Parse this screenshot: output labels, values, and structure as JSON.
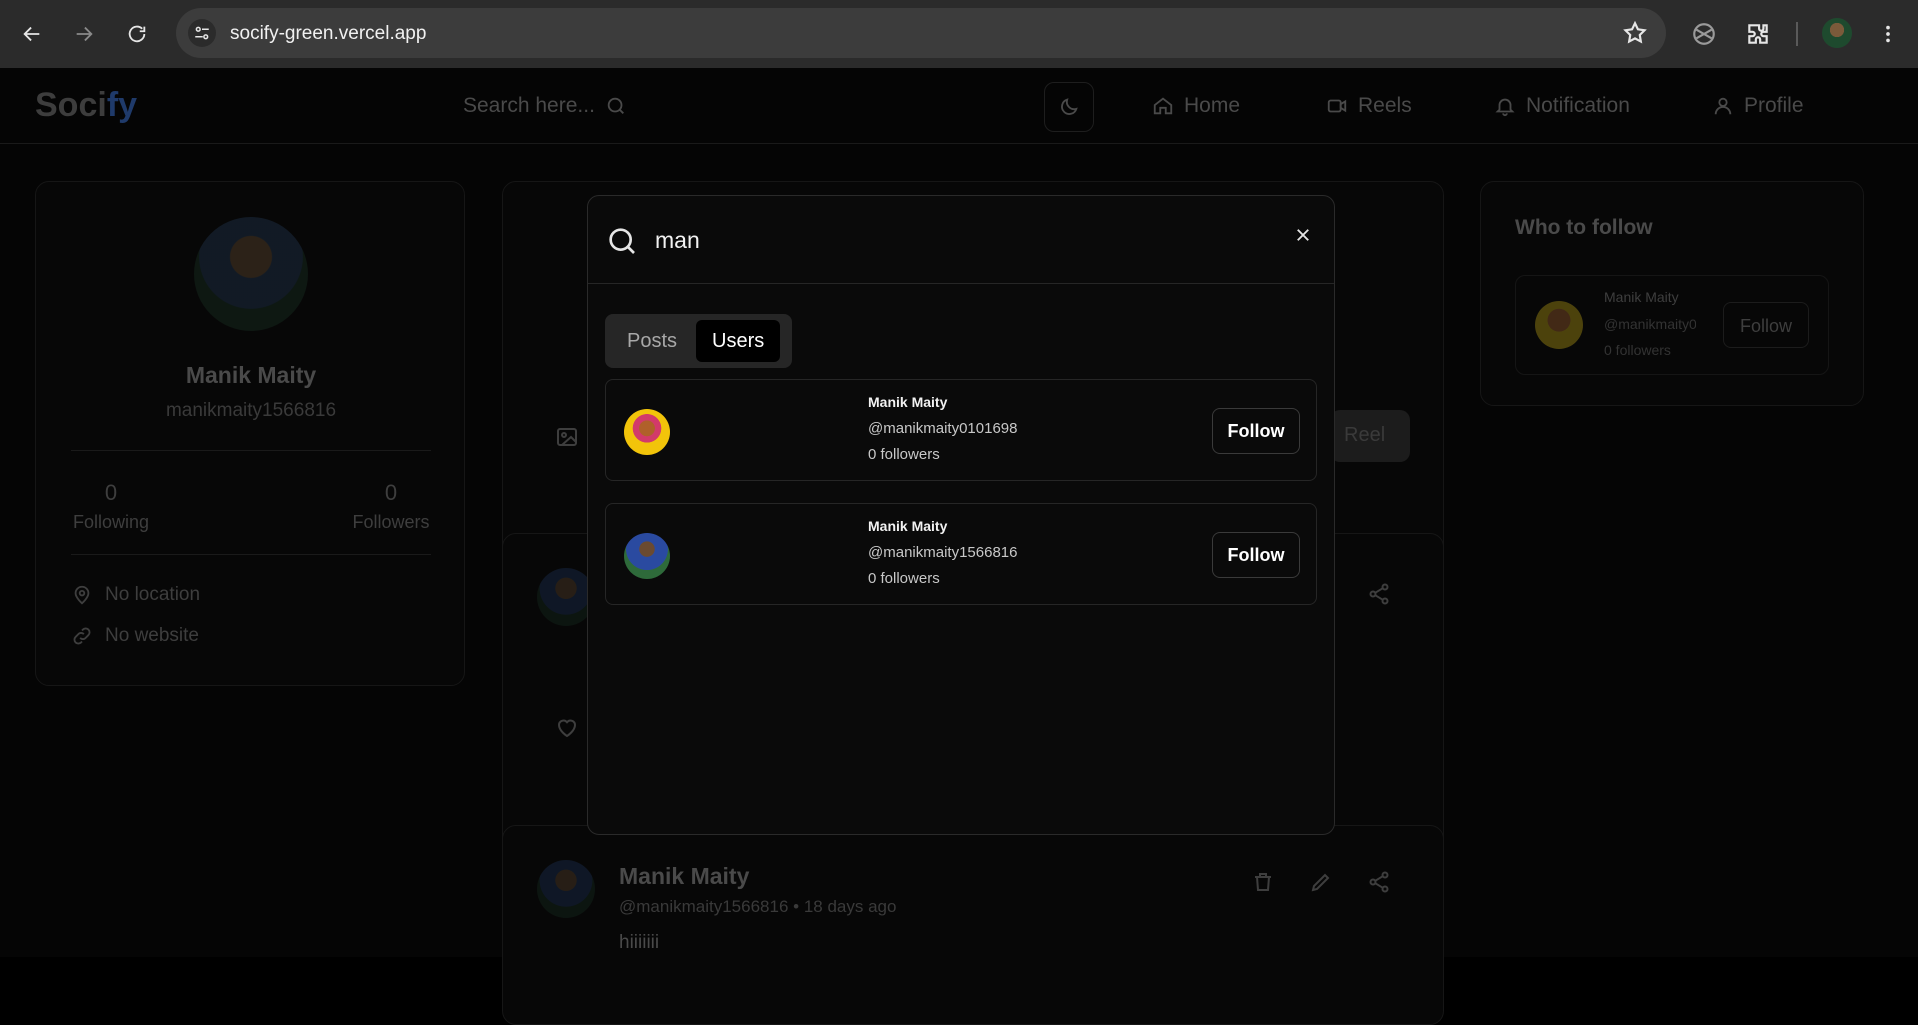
{
  "browser": {
    "url": "socify-green.vercel.app"
  },
  "app": {
    "logo_main": "Soci",
    "logo_accent": "fy",
    "search_placeholder": "Search here...",
    "nav": [
      {
        "label": "Home",
        "icon": "home-icon"
      },
      {
        "label": "Reels",
        "icon": "video-icon"
      },
      {
        "label": "Notification",
        "icon": "bell-icon"
      },
      {
        "label": "Profile",
        "icon": "user-icon"
      }
    ],
    "profile": {
      "name": "Manik Maity",
      "username": "manikmaity1566816",
      "following_count": "0",
      "following_label": "Following",
      "followers_count": "0",
      "followers_label": "Followers",
      "location": "No location",
      "website": "No website"
    },
    "composer": {
      "reel_button_partial": "Reel"
    },
    "post": {
      "author": "Manik Maity",
      "handle": "@manikmaity1566816",
      "separator": "•",
      "time": "18 days ago",
      "body": "hiiiiiii"
    },
    "who_to_follow": {
      "title": "Who to follow",
      "name": "Manik Maity",
      "handle": "@manikmaity0",
      "followers": "0 followers",
      "button": "Follow"
    }
  },
  "modal": {
    "query": "man",
    "tabs": [
      {
        "label": "Posts",
        "active": false
      },
      {
        "label": "Users",
        "active": true
      }
    ],
    "results": [
      {
        "name": "Manik Maity",
        "handle": "@manikmaity0101698",
        "followers": "0 followers",
        "button": "Follow"
      },
      {
        "name": "Manik Maity",
        "handle": "@manikmaity1566816",
        "followers": "0 followers",
        "button": "Follow"
      }
    ]
  },
  "colors": {
    "accent_logo": "#1f3a6a",
    "modal_bg": "#0a0a0a",
    "active_tab_bg": "#000000"
  }
}
